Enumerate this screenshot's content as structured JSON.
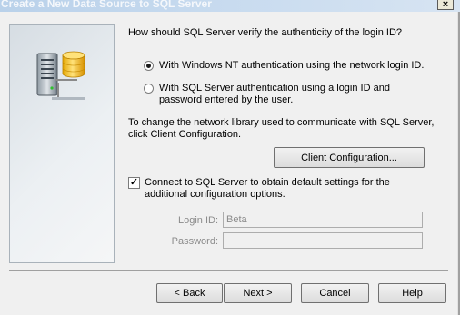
{
  "window": {
    "title": "Create a New Data Source to SQL Server",
    "close_glyph": "×"
  },
  "main": {
    "question": "How should SQL Server verify the authenticity of the login ID?",
    "auth_options": [
      {
        "label": "With Windows NT authentication using the network login ID.",
        "selected": true
      },
      {
        "label": "With SQL Server authentication using a login ID and password entered by the user.",
        "selected": false
      }
    ],
    "network_text": "To change the network library used to communicate with SQL Server, click Client Configuration.",
    "client_config_button": "Client Configuration...",
    "connect_checkbox": {
      "label": "Connect to SQL Server to obtain default settings for the additional configuration options.",
      "checked": true,
      "check_glyph": "✓"
    },
    "login_id": {
      "label": "Login ID:",
      "value": "Beta"
    },
    "password": {
      "label": "Password:",
      "value": ""
    }
  },
  "footer": {
    "back_label": "< Back",
    "next_label": "Next >",
    "cancel_label": "Cancel",
    "help_label": "Help"
  },
  "icons": {
    "illustration": "server-database-icon"
  }
}
